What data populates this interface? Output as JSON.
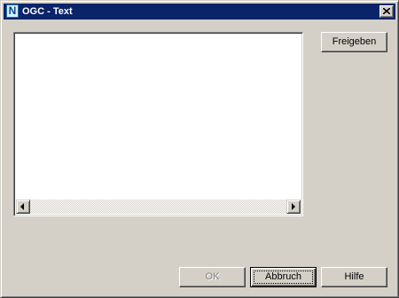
{
  "window": {
    "title": "OGC - Text",
    "app_icon_letter": "N"
  },
  "text_area": {
    "value": ""
  },
  "buttons": {
    "release_label": "Freigeben",
    "ok_label": "OK",
    "ok_enabled": false,
    "cancel_label": "Abbruch",
    "help_label": "Hilfe"
  },
  "colors": {
    "titlebar": "#0a246a",
    "dialog_face": "#d4d0c8",
    "text_area_bg": "#ffffff"
  },
  "icons": {
    "app": "app-icon",
    "close": "close-icon",
    "scroll_left": "arrow-left-icon",
    "scroll_right": "arrow-right-icon"
  }
}
